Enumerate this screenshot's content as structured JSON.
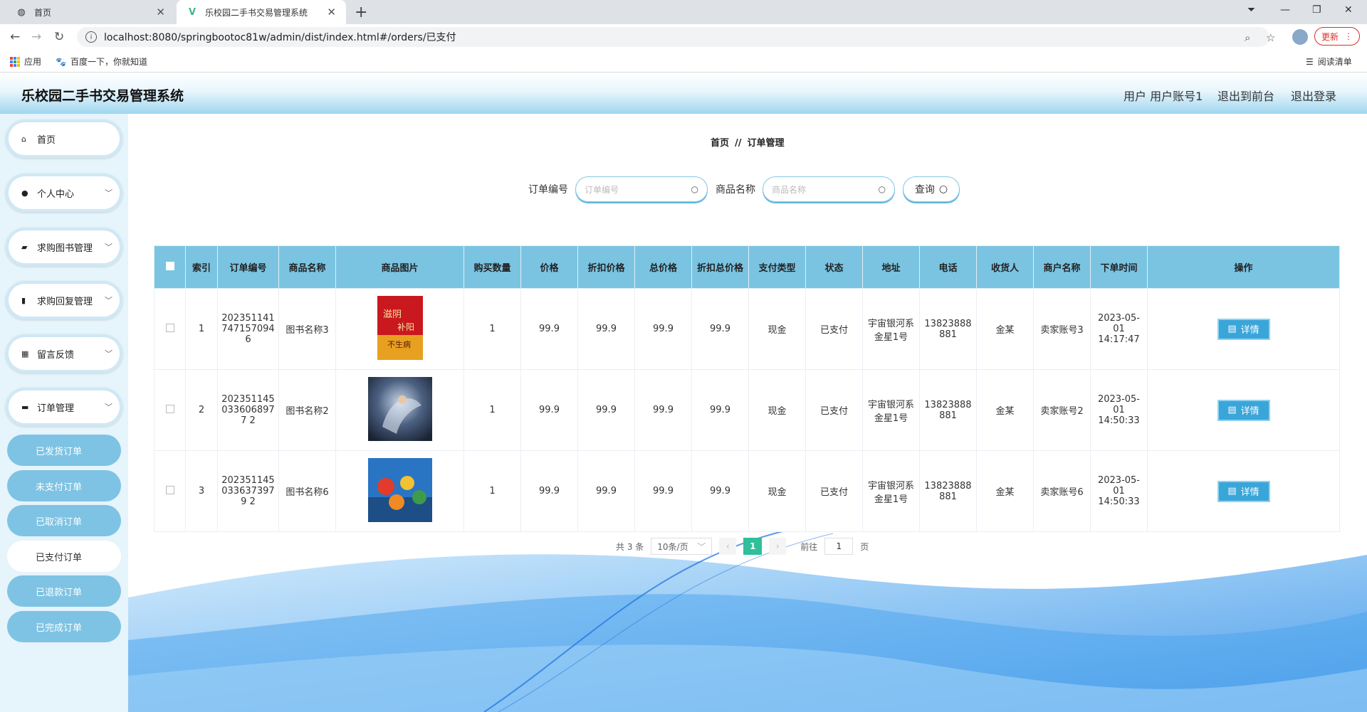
{
  "browser": {
    "tabs": [
      {
        "title": "首页",
        "active": false
      },
      {
        "title": "乐校园二手书交易管理系统",
        "active": true
      }
    ],
    "url": "localhost:8080/springbootoc81w/admin/dist/index.html#/orders/已支付",
    "update_label": "更新",
    "bookmarks": [
      {
        "label": "应用"
      },
      {
        "label": "百度一下，你就知道"
      }
    ],
    "reading_list": "阅读清单"
  },
  "header": {
    "title": "乐校园二手书交易管理系统",
    "user": "用户 用户账号1",
    "back_front": "退出到前台",
    "logout": "退出登录"
  },
  "sidebar": {
    "items": [
      {
        "label": "首页",
        "icon": "home-icon"
      },
      {
        "label": "个人中心",
        "icon": "user-icon"
      },
      {
        "label": "求购图书管理",
        "icon": "cart-icon"
      },
      {
        "label": "求购回复管理",
        "icon": "chart-icon"
      },
      {
        "label": "留言反馈",
        "icon": "grid-icon"
      },
      {
        "label": "订单管理",
        "icon": "order-icon"
      }
    ],
    "sub_items": [
      {
        "label": "已发货订单"
      },
      {
        "label": "未支付订单"
      },
      {
        "label": "已取消订单"
      },
      {
        "label": "已支付订单"
      },
      {
        "label": "已退款订单"
      },
      {
        "label": "已完成订单"
      }
    ]
  },
  "breadcrumb": {
    "home": "首页",
    "sep": "//",
    "current": "订单管理"
  },
  "search": {
    "order_label": "订单编号",
    "order_placeholder": "订单编号",
    "goods_label": "商品名称",
    "goods_placeholder": "商品名称",
    "query": "查询"
  },
  "table": {
    "headers": [
      "索引",
      "订单编号",
      "商品名称",
      "商品图片",
      "购买数量",
      "价格",
      "折扣价格",
      "总价格",
      "折扣总价格",
      "支付类型",
      "状态",
      "地址",
      "电话",
      "收货人",
      "商户名称",
      "下单时间",
      "操作"
    ],
    "detail_label": "详情",
    "rows": [
      {
        "index": "1",
        "order_no": "2023511417471570946",
        "goods": "图书名称3",
        "image": "book-cover-3",
        "qty": "1",
        "price": "99.9",
        "discount_price": "99.9",
        "total": "99.9",
        "discount_total": "99.9",
        "pay_type": "现金",
        "status": "已支付",
        "address": "宇宙银河系金星1号",
        "phone": "13823888881",
        "receiver": "金某",
        "merchant": "卖家账号3",
        "time": "2023-05-01 14:17:47"
      },
      {
        "index": "2",
        "order_no": "2023511450336068977 2",
        "goods": "图书名称2",
        "image": "book-cover-2",
        "qty": "1",
        "price": "99.9",
        "discount_price": "99.9",
        "total": "99.9",
        "discount_total": "99.9",
        "pay_type": "现金",
        "status": "已支付",
        "address": "宇宙银河系金星1号",
        "phone": "13823888881",
        "receiver": "金某",
        "merchant": "卖家账号2",
        "time": "2023-05-01 14:50:33"
      },
      {
        "index": "3",
        "order_no": "2023511450336373979 2",
        "goods": "图书名称6",
        "image": "book-cover-6",
        "qty": "1",
        "price": "99.9",
        "discount_price": "99.9",
        "total": "99.9",
        "discount_total": "99.9",
        "pay_type": "现金",
        "status": "已支付",
        "address": "宇宙银河系金星1号",
        "phone": "13823888881",
        "receiver": "金某",
        "merchant": "卖家账号6",
        "time": "2023-05-01 14:50:33"
      }
    ]
  },
  "pagination": {
    "total": "共 3 条",
    "page_size": "10条/页",
    "current": "1",
    "goto": "前往",
    "goto_value": "1",
    "page_unit": "页"
  }
}
